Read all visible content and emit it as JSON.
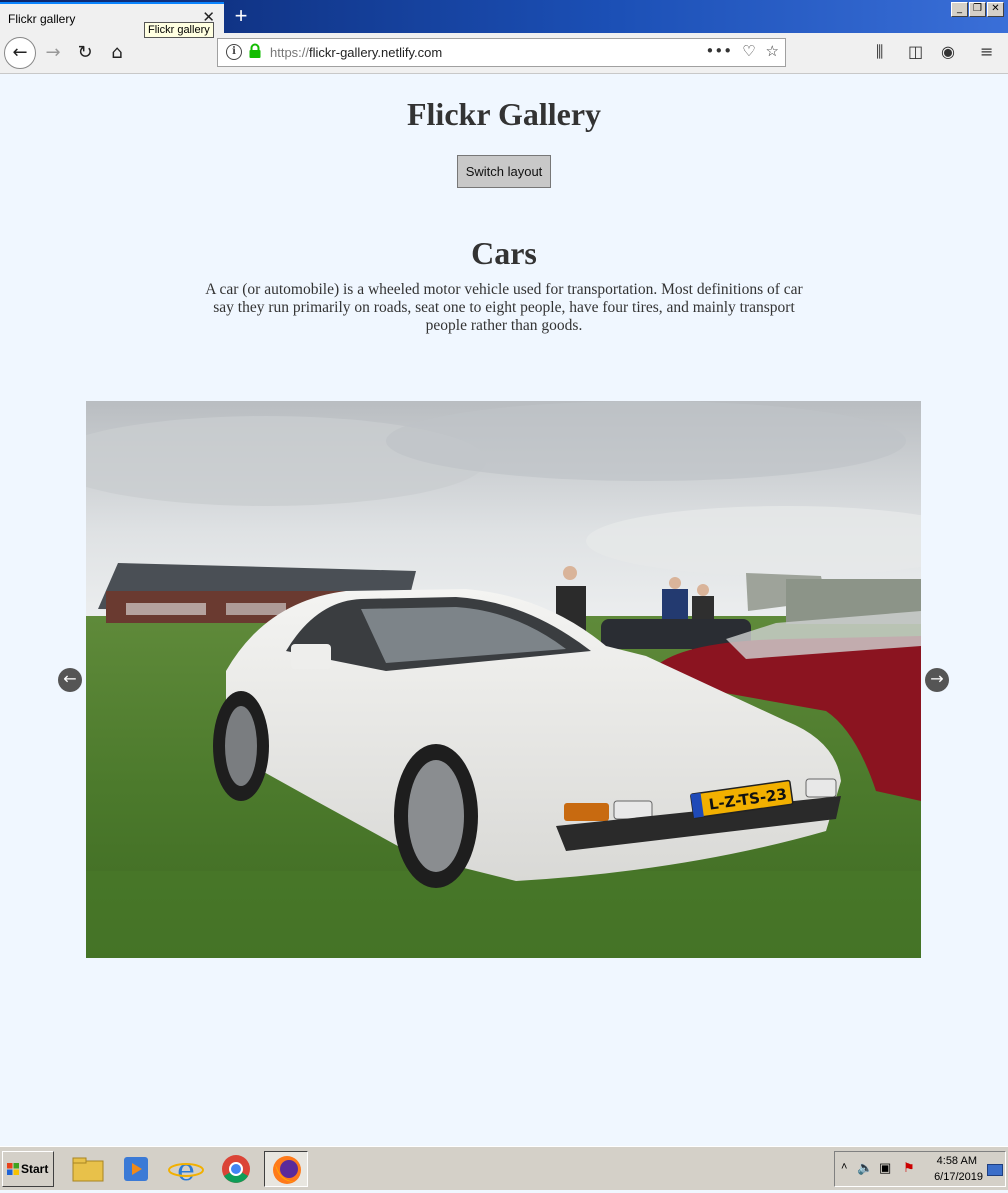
{
  "browser": {
    "tab_title": "Flickr gallery",
    "tooltip": "Flickr gallery",
    "url_scheme": "https://",
    "url_host": "flickr-gallery.netlify.com"
  },
  "page": {
    "title": "Flickr Gallery",
    "switch_button": "Switch layout",
    "section_title": "Cars",
    "description": "A car (or automobile) is a wheeled motor vehicle used for transportation. Most definitions of car say they run primarily on roads, seat one to eight people, have four tires, and mainly transport people rather than goods.",
    "prev_arrow": "←",
    "next_arrow": "→",
    "license_plate": "L-Z-TS-23"
  },
  "taskbar": {
    "start_label": "Start",
    "time": "4:58 AM",
    "date": "6/17/2019"
  },
  "icons": [
    "back-icon",
    "forward-icon",
    "reload-icon",
    "home-icon",
    "info-icon",
    "lock-icon",
    "more-icon",
    "pocket-icon",
    "star-icon",
    "library-icon",
    "sidebar-icon",
    "account-icon",
    "menu-icon"
  ],
  "colors": {
    "page_bg": "#f0f7ff",
    "text": "#333333",
    "lock": "#12bc00"
  }
}
